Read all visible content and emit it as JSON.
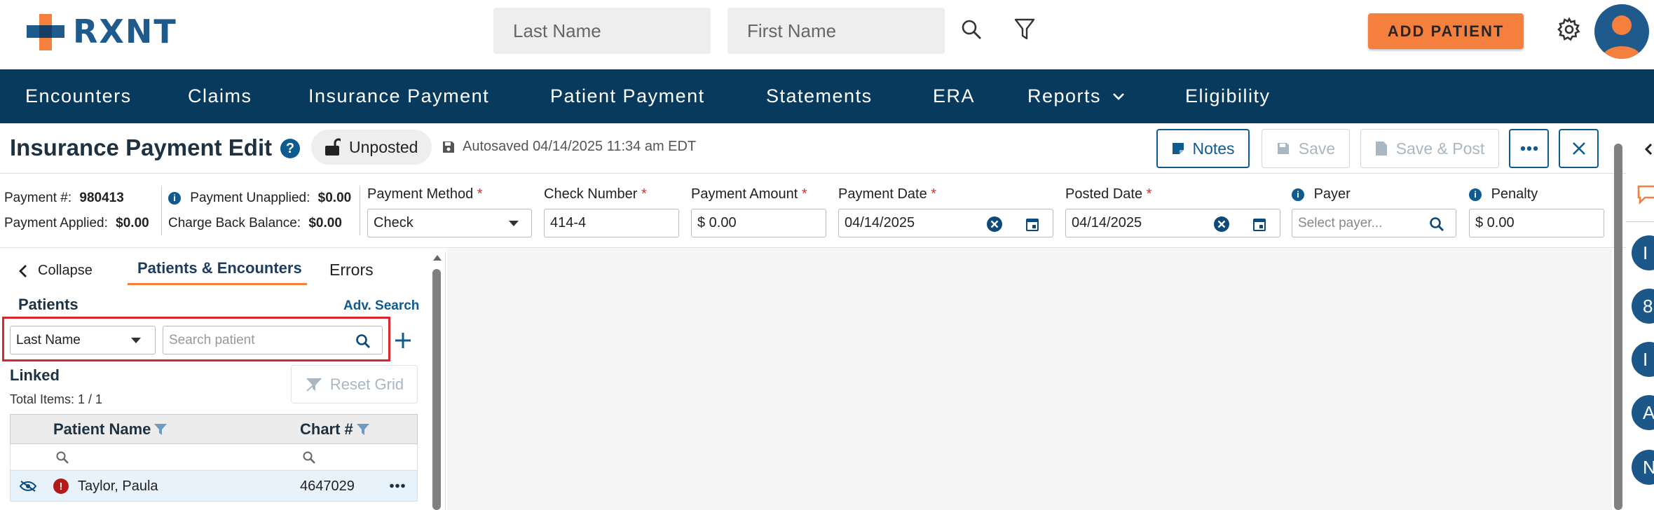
{
  "header": {
    "logo_text": "RXNT",
    "last_name_placeholder": "Last Name",
    "first_name_placeholder": "First Name",
    "add_patient_label": "ADD PATIENT"
  },
  "nav": {
    "items": [
      "Encounters",
      "Claims",
      "Insurance Payment",
      "Patient Payment",
      "Statements",
      "ERA",
      "Reports",
      "Eligibility"
    ]
  },
  "page": {
    "title": "Insurance Payment Edit",
    "help": "?",
    "status": "Unposted",
    "autosaved": "Autosaved 04/14/2025 11:34 am EDT",
    "notes_label": "Notes",
    "save_label": "Save",
    "save_post_label": "Save & Post"
  },
  "payment": {
    "number_label": "Payment #:",
    "number_value": "980413",
    "applied_label": "Payment Applied:",
    "applied_value": "$0.00",
    "unapplied_label": "Payment Unapplied:",
    "unapplied_value": "$0.00",
    "chargeback_label": "Charge Back Balance:",
    "chargeback_value": "$0.00",
    "method_label": "Payment Method",
    "method_value": "Check",
    "check_label": "Check Number",
    "check_value": "414-4",
    "amount_label": "Payment Amount",
    "amount_value": "$ 0.00",
    "date_label": "Payment Date",
    "date_value": "04/14/2025",
    "posted_label": "Posted Date",
    "posted_value": "04/14/2025",
    "payer_label": "Payer",
    "payer_placeholder": "Select payer...",
    "penalty_label": "Penalty",
    "penalty_value": "$ 0.00",
    "required_mark": "*",
    "info_mark": "i"
  },
  "left": {
    "collapse_label": "Collapse",
    "tab_patients": "Patients & Encounters",
    "tab_errors": "Errors",
    "patients_heading": "Patients",
    "adv_search": "Adv. Search",
    "search_by": "Last Name",
    "search_placeholder": "Search patient",
    "linked_heading": "Linked",
    "total_items": "Total Items: 1 / 1",
    "reset_grid": "Reset Grid",
    "col_patient": "Patient Name",
    "col_chart": "Chart #",
    "rows": [
      {
        "name": "Taylor, Paula",
        "chart": "4647029",
        "alert": "!"
      }
    ]
  },
  "side": {
    "letters": [
      "I",
      "8",
      "I",
      "A",
      "N"
    ]
  },
  "colors": {
    "brand_blue": "#1e5b8c",
    "nav_bg": "#083a5e",
    "accent_orange": "#f57f3d",
    "highlight_red": "#d9252b"
  }
}
